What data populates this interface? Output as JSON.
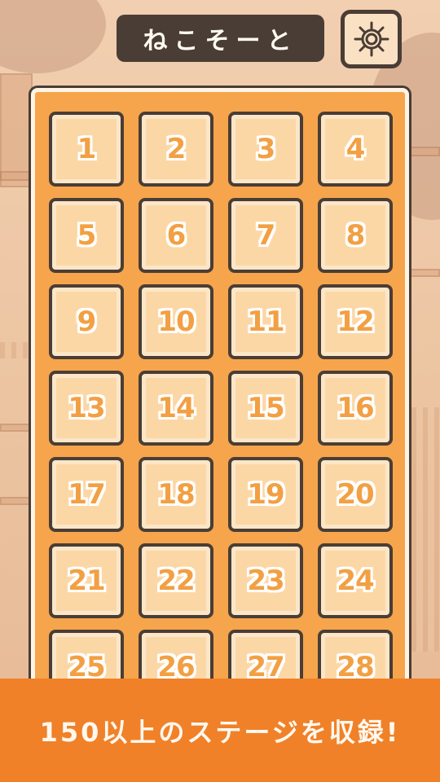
{
  "app": {
    "title": "ねこそーと"
  },
  "header": {
    "settings_icon": "gear-icon"
  },
  "stages": [
    "1",
    "2",
    "3",
    "4",
    "5",
    "6",
    "7",
    "8",
    "9",
    "10",
    "11",
    "12",
    "13",
    "14",
    "15",
    "16",
    "17",
    "18",
    "19",
    "20",
    "21",
    "22",
    "23",
    "24",
    "25",
    "26",
    "27",
    "28"
  ],
  "banner": {
    "text": "150以上のステージを収録!"
  },
  "colors": {
    "panel": "#f6a54c",
    "button": "#fcd7a6",
    "outline": "#4a3d35",
    "number": "#f2a043",
    "banner": "#f08128"
  }
}
